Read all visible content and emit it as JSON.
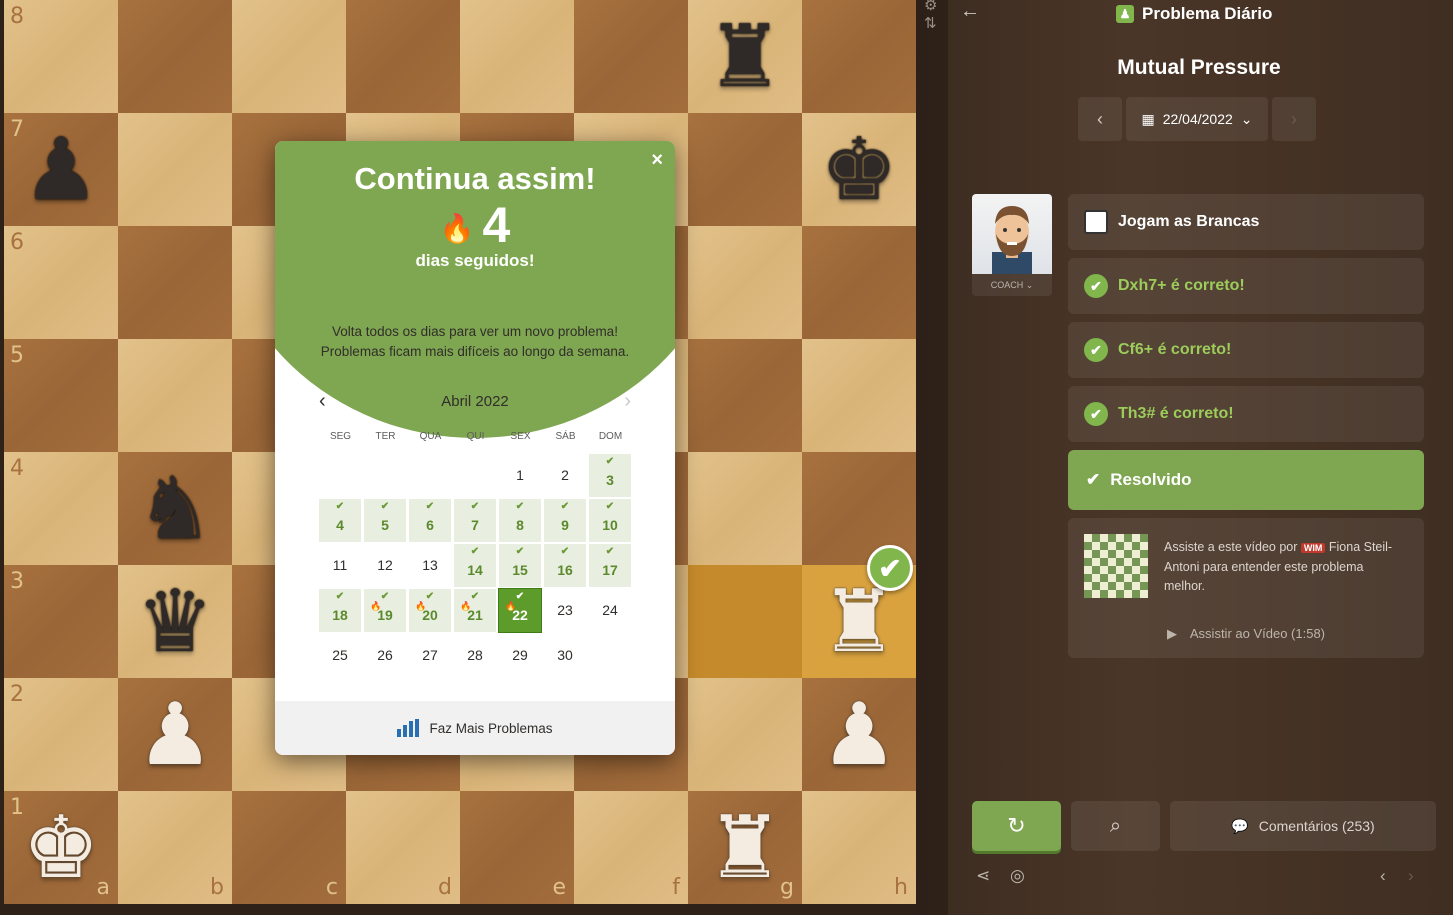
{
  "board": {
    "ranks": [
      "8",
      "7",
      "6",
      "5",
      "4",
      "3",
      "2",
      "1"
    ],
    "files": [
      "a",
      "b",
      "c",
      "d",
      "e",
      "f",
      "g",
      "h"
    ],
    "pieces": [
      {
        "sq": "g8",
        "glyph": "♜",
        "color": "black",
        "icon": "black-rook-icon"
      },
      {
        "sq": "a7",
        "glyph": "♟",
        "color": "black",
        "icon": "black-pawn-icon"
      },
      {
        "sq": "h7",
        "glyph": "♚",
        "color": "black",
        "icon": "black-king-icon"
      },
      {
        "sq": "b4",
        "glyph": "♞",
        "color": "black",
        "icon": "black-knight-icon"
      },
      {
        "sq": "b3",
        "glyph": "♛",
        "color": "black",
        "icon": "black-queen-icon"
      },
      {
        "sq": "h3",
        "glyph": "♜",
        "color": "white",
        "icon": "white-rook-icon"
      },
      {
        "sq": "b2",
        "glyph": "♟",
        "color": "white",
        "icon": "white-pawn-icon"
      },
      {
        "sq": "h2",
        "glyph": "♟",
        "color": "white",
        "icon": "white-pawn-icon"
      },
      {
        "sq": "a1",
        "glyph": "♚",
        "color": "white",
        "icon": "white-king-icon"
      },
      {
        "sq": "g1",
        "glyph": "♜",
        "color": "white",
        "icon": "white-rook-icon"
      }
    ],
    "highlight": [
      "g3",
      "h3"
    ],
    "solved_badge_icon": "check-icon"
  },
  "modal": {
    "close": "×",
    "title": "Continua assim!",
    "flame": "🔥",
    "streak": "4",
    "streak_label": "dias seguidos!",
    "desc_line1": "Volta todos os dias para ver um novo problema!",
    "desc_line2": "Problemas ficam mais difíceis ao longo da semana.",
    "prev": "‹",
    "next": "›",
    "month": "Abril 2022",
    "weekdays": [
      "SEG",
      "TER",
      "QUA",
      "QUI",
      "SEX",
      "SÁB",
      "DOM"
    ],
    "days": [
      {
        "d": ""
      },
      {
        "d": ""
      },
      {
        "d": ""
      },
      {
        "d": ""
      },
      {
        "d": "1"
      },
      {
        "d": "2"
      },
      {
        "d": "3",
        "done": true
      },
      {
        "d": "4",
        "done": true
      },
      {
        "d": "5",
        "done": true
      },
      {
        "d": "6",
        "done": true
      },
      {
        "d": "7",
        "done": true
      },
      {
        "d": "8",
        "done": true
      },
      {
        "d": "9",
        "done": true
      },
      {
        "d": "10",
        "done": true
      },
      {
        "d": "11"
      },
      {
        "d": "12"
      },
      {
        "d": "13"
      },
      {
        "d": "14",
        "done": true
      },
      {
        "d": "15",
        "done": true
      },
      {
        "d": "16",
        "done": true
      },
      {
        "d": "17",
        "done": true
      },
      {
        "d": "18",
        "done": true
      },
      {
        "d": "19",
        "done": true,
        "flame": true
      },
      {
        "d": "20",
        "done": true,
        "flame": true
      },
      {
        "d": "21",
        "done": true,
        "flame": true
      },
      {
        "d": "22",
        "done": true,
        "flame": true,
        "today": true
      },
      {
        "d": "23"
      },
      {
        "d": "24"
      },
      {
        "d": "25"
      },
      {
        "d": "26"
      },
      {
        "d": "27"
      },
      {
        "d": "28"
      },
      {
        "d": "29"
      },
      {
        "d": "30"
      }
    ],
    "check_mark": "✔",
    "footer_label": "Faz Mais Problemas"
  },
  "panel": {
    "header_title": "Problema Diário",
    "puzzle_title": "Mutual Pressure",
    "date": "22/04/2022",
    "coach_label": "COACH ⌄",
    "moves": [
      {
        "text": "Jogam as Brancas",
        "status": "to-move"
      },
      {
        "text": "Dxh7+ é correto!",
        "status": "correct"
      },
      {
        "text": "Cf6+ é correto!",
        "status": "correct"
      },
      {
        "text": "Th3# é correto!",
        "status": "correct"
      }
    ],
    "resolved_label": "Resolvido",
    "video_text_before": "Assiste a este vídeo por",
    "video_title_badge": "WIM",
    "video_text_after": "Fiona Steil-Antoni para entender este problema melhor.",
    "video_link": "Assistir ao Vídeo (1:58)",
    "comments_label": "Comentários (253)"
  },
  "colors": {
    "accent_green": "#81b64c",
    "modal_green": "#7fa650",
    "highlight": "#d9a23f"
  }
}
